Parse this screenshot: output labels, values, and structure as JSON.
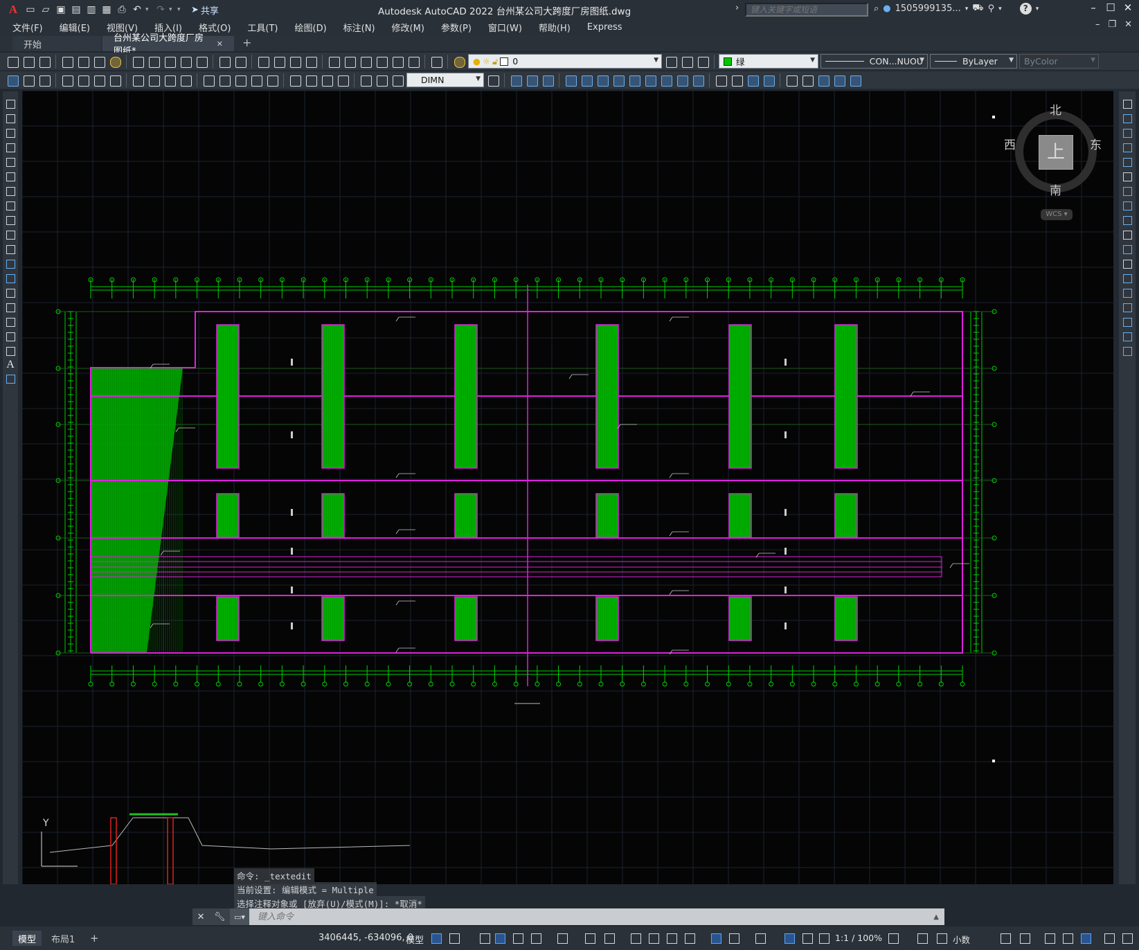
{
  "app": {
    "title": "Autodesk AutoCAD 2022    台州某公司大跨度厂房图纸.dwg",
    "logo": "A",
    "share_label": "共享",
    "search_placeholder": "键入关键字或短语",
    "user": "1505999135...",
    "help": "?"
  },
  "menu": [
    "文件(F)",
    "编辑(E)",
    "视图(V)",
    "插入(I)",
    "格式(O)",
    "工具(T)",
    "绘图(D)",
    "标注(N)",
    "修改(M)",
    "参数(P)",
    "窗口(W)",
    "帮助(H)",
    "Express"
  ],
  "tabs": {
    "start": "开始",
    "document": "台州某公司大跨度厂房图纸*",
    "close": "✕",
    "add": "+"
  },
  "toolbar": {
    "layer_value": "0",
    "color_value": "绿",
    "color_hex": "#00c800",
    "linetype_value": "CON...NUOU",
    "lineweight_value": "ByLayer",
    "plotstyle_value": "ByColor",
    "dimstyle_value": "DIMN"
  },
  "viewcube": {
    "north": "北",
    "south": "南",
    "east": "东",
    "west": "西",
    "face": "上",
    "wcs": "WCS"
  },
  "drawing": {
    "ucs_y_label": "Y",
    "colors": {
      "background": "#050505",
      "grid": "#1a2230",
      "axis_lines": "#00d000",
      "outline": "#e020e0",
      "panels": "#00a000",
      "text": "#d0d0d0"
    }
  },
  "command": {
    "history": [
      "命令:  _textedit",
      "当前设置: 编辑模式 = Multiple",
      "选择注释对象或 [放弃(U)/模式(M)]: *取消*"
    ],
    "placeholder": "键入命令"
  },
  "statusbar": {
    "tab_model": "模型",
    "tab_layout1": "布局1",
    "tab_add": "+",
    "coords": "3406445, -634096, 0",
    "mode_label": "模型",
    "scale": "1:1 / 100%",
    "units": "小数"
  }
}
